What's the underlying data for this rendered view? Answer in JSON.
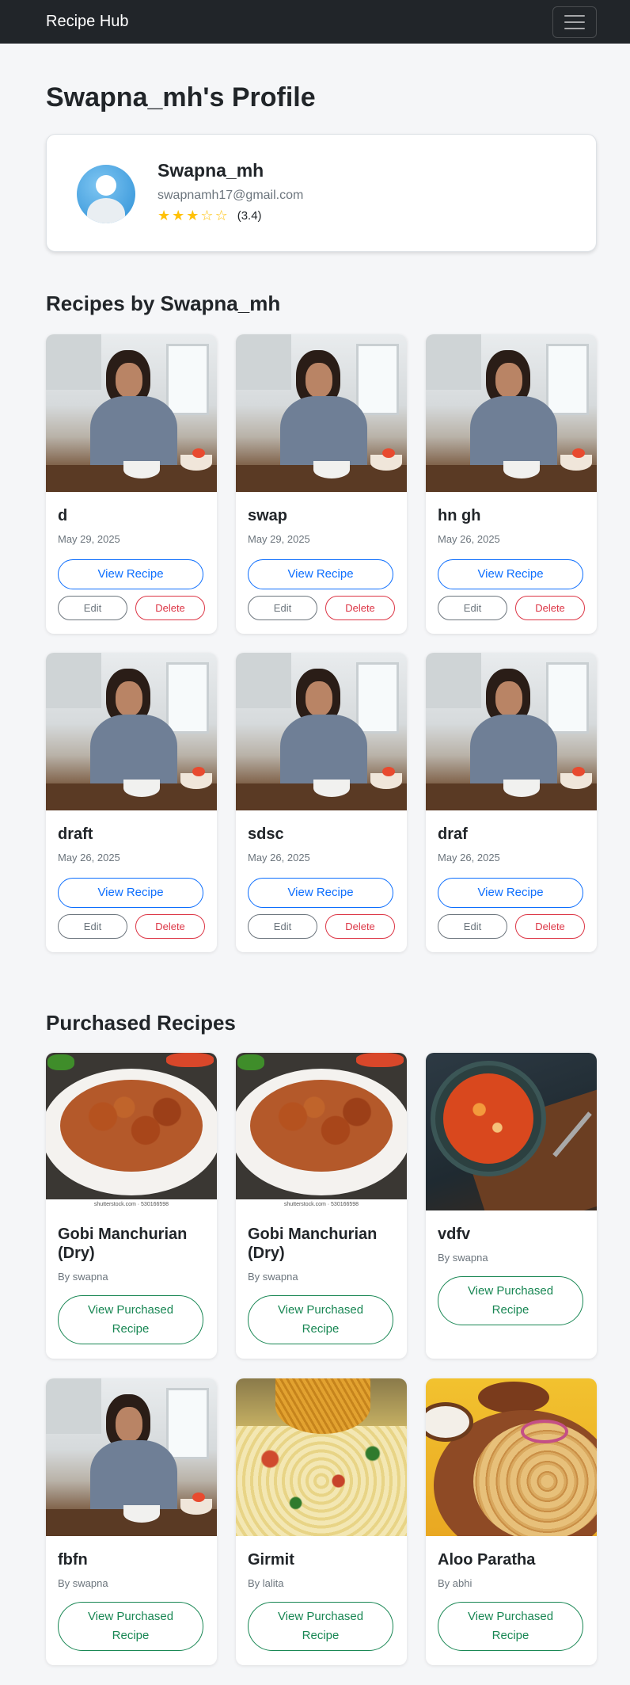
{
  "navbar": {
    "brand": "Recipe Hub",
    "menu_icon": "hamburger-icon"
  },
  "profile": {
    "title": "Swapna_mh's Profile",
    "name": "Swapna_mh",
    "email": "swapnamh17@gmail.com",
    "rating": 3.4,
    "rating_label": "(3.4)",
    "stars": [
      "★",
      "★",
      "★",
      "☆",
      "☆"
    ],
    "avatar_icon": "user-avatar-icon"
  },
  "colors": {
    "primary": "#0d6efd",
    "danger": "#dc3545",
    "success": "#198754",
    "secondary": "#6c757d",
    "star": "#ffc107",
    "navbar": "#212529"
  },
  "recipes_section": {
    "title": "Recipes by Swapna_mh",
    "view_label": "View Recipe",
    "edit_label": "Edit",
    "delete_label": "Delete",
    "items": [
      {
        "title": "d",
        "date": "May 29, 2025"
      },
      {
        "title": "swap",
        "date": "May 29, 2025"
      },
      {
        "title": "hn gh",
        "date": "May 26, 2025"
      },
      {
        "title": "draft",
        "date": "May 26, 2025"
      },
      {
        "title": "sdsc",
        "date": "May 26, 2025"
      },
      {
        "title": "draf",
        "date": "May 26, 2025"
      }
    ]
  },
  "purchased_section": {
    "title": "Purchased Recipes",
    "view_label": "View Purchased Recipe",
    "items": [
      {
        "title": "Gobi Manchurian (Dry)",
        "author": "By swapna",
        "watermark": "shutterstock.com · 530166598"
      },
      {
        "title": "Gobi Manchurian (Dry)",
        "author": "By swapna",
        "watermark": "shutterstock.com · 530166598"
      },
      {
        "title": "vdfv",
        "author": "By swapna"
      },
      {
        "title": "fbfn",
        "author": "By swapna"
      },
      {
        "title": "Girmit",
        "author": "By lalita"
      },
      {
        "title": "Aloo Paratha",
        "author": "By abhi"
      }
    ]
  }
}
